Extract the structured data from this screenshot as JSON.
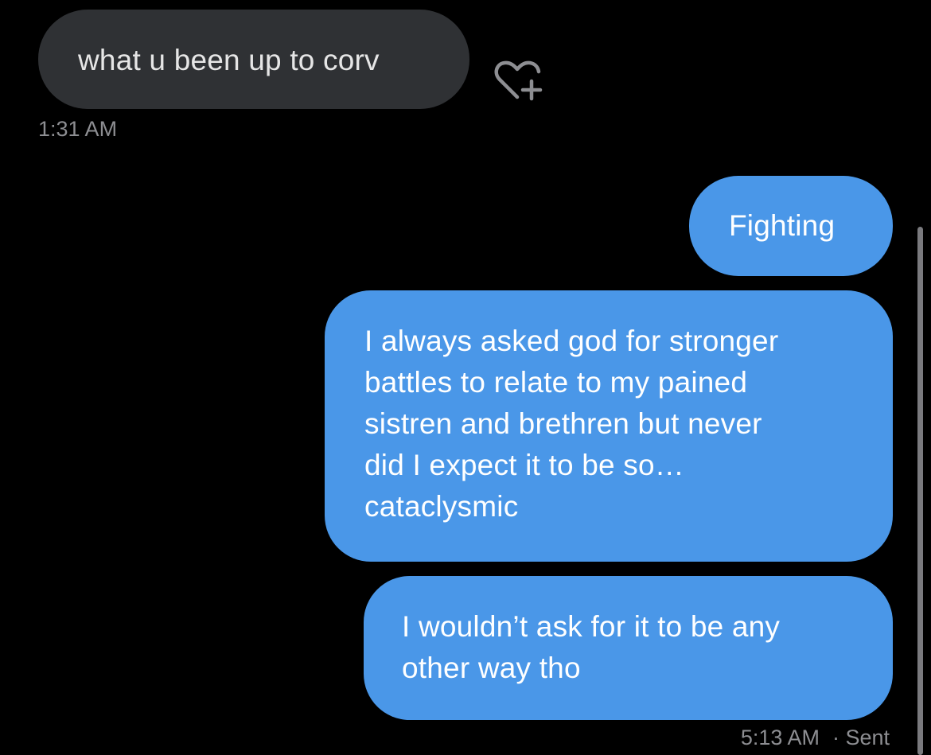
{
  "messages": [
    {
      "direction": "received",
      "text": "what u been up to corv",
      "time": "1:31 AM"
    }
  ],
  "sent": {
    "bubbles": [
      {
        "lines": [
          "Fighting"
        ]
      },
      {
        "lines": [
          "I always asked god for stronger",
          "battles to relate to my pained",
          "sistren and brethren but never",
          "did I expect it to be so…",
          "cataclysmic"
        ]
      },
      {
        "lines": [
          "I wouldn’t ask for it to be any",
          "other way tho"
        ]
      }
    ],
    "time": "5:13 AM",
    "status": "· Sent"
  },
  "icons": {
    "react": "heart-plus-icon"
  },
  "colors": {
    "background": "#000000",
    "received_bubble": "#2f3134",
    "sent_bubble": "#4a97e8",
    "timestamp": "#8d8e92"
  }
}
